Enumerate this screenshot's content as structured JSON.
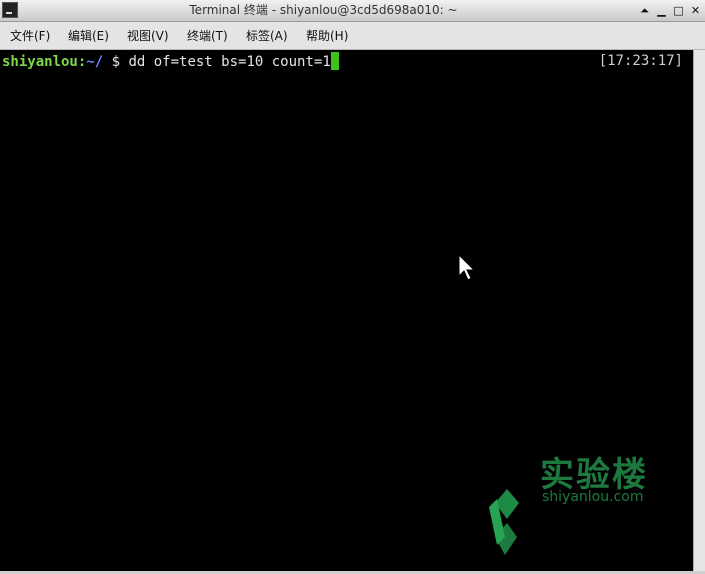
{
  "window": {
    "title": "Terminal 终端 - shiyanlou@3cd5d698a010: ~",
    "controls": [
      "⏶",
      "▁",
      "□",
      "✕"
    ]
  },
  "menu": [
    {
      "label": "文件(F)"
    },
    {
      "label": "编辑(E)"
    },
    {
      "label": "视图(V)"
    },
    {
      "label": "终端(T)"
    },
    {
      "label": "标签(A)"
    },
    {
      "label": "帮助(H)"
    }
  ],
  "terminal": {
    "user": "shiyanlou",
    "sep": ":",
    "path": "~/",
    "prompt": " $ ",
    "command": "dd of=test bs=10 count=1",
    "clock": "[17:23:17]"
  },
  "watermark": {
    "brand": "实验楼",
    "site": "shiyanlou.com"
  },
  "colors": {
    "prompt_user": "#7cd94a",
    "prompt_path": "#6f86ff",
    "cursor": "#3ec21a",
    "watermark": "#1d7a3e"
  }
}
